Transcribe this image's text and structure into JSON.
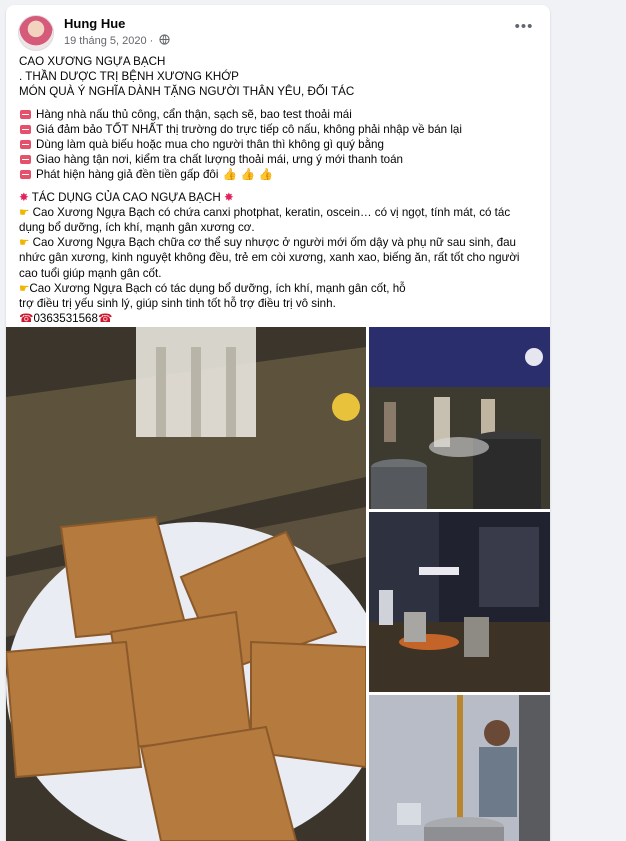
{
  "post": {
    "author": "Hung Hue",
    "date": "19 tháng 5, 2020",
    "dot": "·",
    "more_icon": "ellipsis-icon",
    "lines": [
      {
        "type": "plain",
        "text": "CAO XƯƠNG NGỰA BẠCH"
      },
      {
        "type": "plain",
        "text": ". THẦN DƯỢC TRỊ BỆNH XƯƠNG KHỚP"
      },
      {
        "type": "plain",
        "text": " MÓN QUÀ Ý NGHĨA DÀNH TẶNG NGƯỜI THÂN YÊU, ĐỐI TÁC"
      },
      {
        "type": "blank",
        "text": ""
      },
      {
        "type": "bullet",
        "text": "Hàng nhà nấu thủ công, cẩn thận, sạch sẽ, bao test thoải mái"
      },
      {
        "type": "bullet",
        "text": "Giá đảm bảo TỐT NHẤT thị trường do trực tiếp cô nấu, không phải nhập về bán lại"
      },
      {
        "type": "bullet",
        "text": "Dùng làm quà biếu hoặc mua cho người thân thì không gì quý bằng"
      },
      {
        "type": "bullet",
        "text": "Giao hàng tận nơi, kiểm tra chất lượng thoải mái, ưng ý mới thanh toán"
      },
      {
        "type": "bullet",
        "text": "Phát hiện hàng giả đền tiền gấp đôi",
        "suffix": "👍 👍 👍"
      },
      {
        "type": "blank",
        "text": ""
      },
      {
        "type": "boom",
        "text": " TÁC DỤNG CỦA CAO NGỰA BẠCH "
      },
      {
        "type": "hand",
        "text": " Cao Xương Ngựa Bạch có chứa canxi photphat, keratin, oscein… có vị ngọt, tính mát, có tác"
      },
      {
        "type": "plain",
        "text": "dụng bổ dưỡng, ích khí, mạnh gân xương cơ."
      },
      {
        "type": "hand",
        "text": " Cao Xương Ngựa Bạch chữa cơ thể suy nhược ở người mới ốm dậy và phụ nữ sau sinh, đau"
      },
      {
        "type": "plain",
        "text": "nhức gân xương, kinh nguyệt không đều, trẻ em còi xương, xanh xao, biếng ăn, rất tốt cho người"
      },
      {
        "type": "plain",
        "text": "cao tuổi giúp mạnh gân cốt."
      },
      {
        "type": "hand",
        "text": "Cao Xương Ngựa Bạch có tác dụng bổ dưỡng, ích khí, mạnh gân cốt, hỗ"
      },
      {
        "type": "plain",
        "text": "trợ điều trị yếu sinh lý, giúp sinh tinh tốt hỗ trợ điều trị vô sinh."
      },
      {
        "type": "phone",
        "text": "0363531568"
      }
    ]
  },
  "photos": [
    {
      "name": "photo-horse-bone-glue-blocks"
    },
    {
      "name": "photo-night-cooking-pots"
    },
    {
      "name": "photo-night-fire-cooking"
    },
    {
      "name": "photo-man-stirring-pot"
    }
  ],
  "colors": {
    "background": "#f0f2f5",
    "card": "#ffffff",
    "meta_text": "#65676b",
    "bullet_red": "#e5506a",
    "glue_block": "#b47a3e"
  }
}
